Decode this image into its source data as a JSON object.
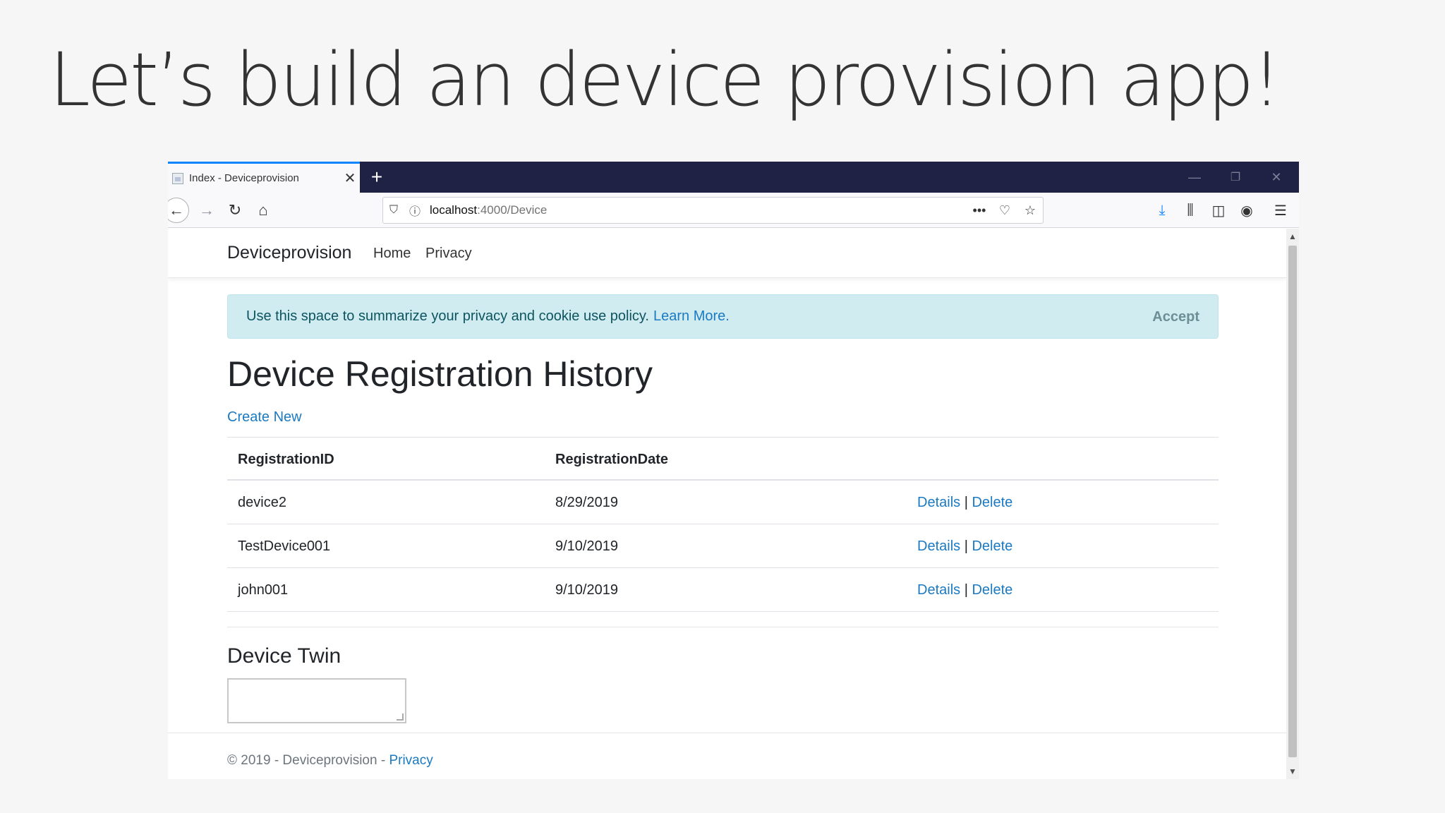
{
  "slide": {
    "title": "Let’s build an device provision app!"
  },
  "browser": {
    "tab": {
      "title": "Index - Deviceprovision",
      "close": "✕"
    },
    "new_tab": "+",
    "window_controls": {
      "minimize": "—",
      "restore": "❐",
      "close": "✕"
    },
    "nav_icons": {
      "back": "←",
      "forward": "→",
      "reload": "↻",
      "home": "⌂"
    },
    "url": {
      "host": "localhost",
      "path": ":4000/Device"
    },
    "url_icons": {
      "shield": "⛉",
      "info": "ⓘ",
      "more": "•••",
      "pocket": "♡",
      "star": "☆"
    },
    "toolbar_icons": {
      "download": "⤓",
      "library": "⫼",
      "sidebar": "◫",
      "account": "◉",
      "menu": "☰"
    },
    "scroll_arrows": {
      "up": "▲",
      "down": "▼"
    }
  },
  "site": {
    "brand": "Deviceprovision",
    "nav": [
      {
        "label": "Home"
      },
      {
        "label": "Privacy"
      }
    ],
    "cookie_alert": {
      "text": "Use this space to summarize your privacy and cookie use policy.",
      "link": "Learn More.",
      "accept": "Accept"
    },
    "heading": "Device Registration History",
    "create_new": "Create New",
    "table": {
      "headers": [
        "RegistrationID",
        "RegistrationDate"
      ],
      "rows": [
        {
          "id": "device2",
          "date": "8/29/2019",
          "details": "Details",
          "sep": "|",
          "delete": "Delete"
        },
        {
          "id": "TestDevice001",
          "date": "9/10/2019",
          "details": "Details",
          "sep": "|",
          "delete": "Delete"
        },
        {
          "id": "john001",
          "date": "9/10/2019",
          "details": "Details",
          "sep": "|",
          "delete": "Delete"
        }
      ]
    },
    "device_twin": {
      "title": "Device Twin",
      "value": ""
    },
    "footer": {
      "text": "© 2019 - Deviceprovision - ",
      "link": "Privacy"
    }
  }
}
